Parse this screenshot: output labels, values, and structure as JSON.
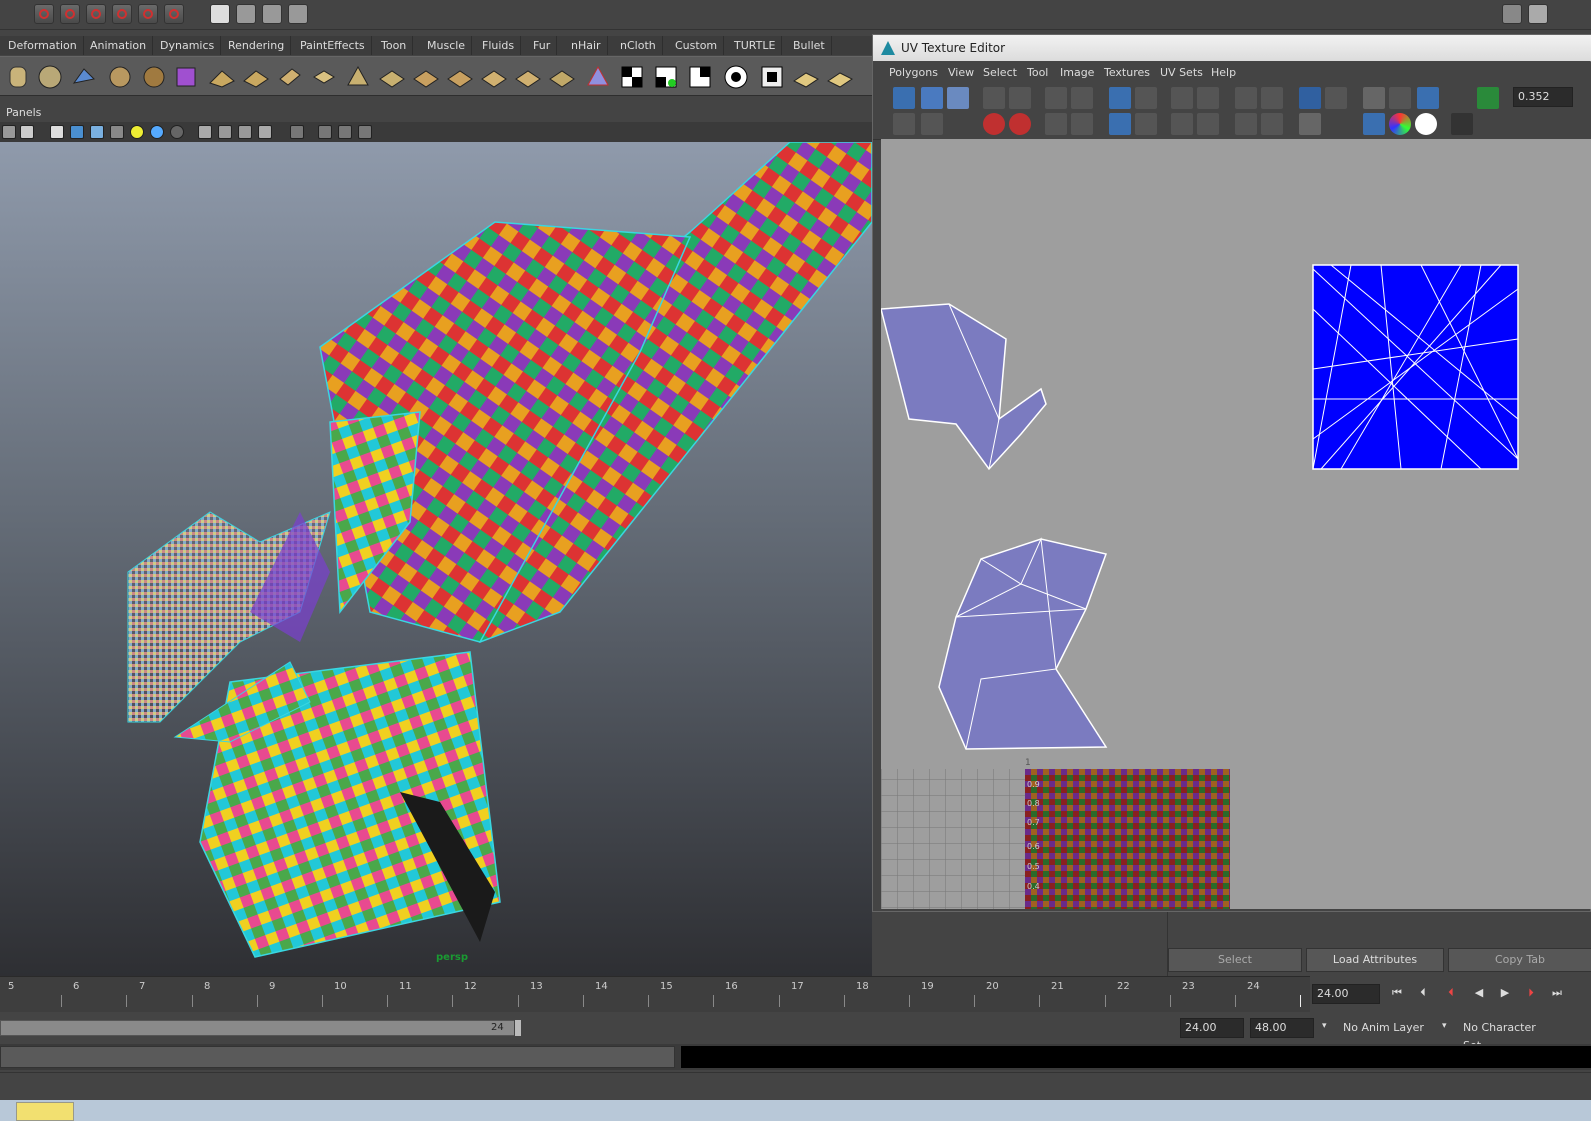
{
  "shelf_tabs": [
    "Deformation",
    "Animation",
    "Dynamics",
    "Rendering",
    "PaintEffects",
    "Toon",
    "Muscle",
    "Fluids",
    "Fur",
    "nHair",
    "nCloth",
    "Custom",
    "TURTLE",
    "Bullet"
  ],
  "panels_menu": "Panels",
  "camera_label": "persp",
  "uv_editor": {
    "title": "UV Texture Editor",
    "menus": [
      "Polygons",
      "View",
      "Select",
      "Tool",
      "Image",
      "Textures",
      "UV Sets",
      "Help"
    ],
    "value": "0.352",
    "tile_label": "1",
    "texture_labels": [
      "0.9",
      "0.8",
      "0.7",
      "0.6",
      "0.5",
      "0.4"
    ]
  },
  "attribute_buttons": [
    "Select",
    "Load Attributes",
    "Copy Tab"
  ],
  "timeline": {
    "ticks": [
      "5",
      "6",
      "7",
      "8",
      "9",
      "10",
      "11",
      "12",
      "13",
      "14",
      "15",
      "16",
      "17",
      "18",
      "19",
      "20",
      "21",
      "22",
      "23",
      "24"
    ],
    "current_time": "24.00"
  },
  "range": {
    "slider_label": "24",
    "end_time": "24.00",
    "playback_end": "48.00",
    "anim_layer": "No Anim Layer",
    "character_set": "No Character Set"
  },
  "colors": {
    "uv_shell_fill": "#7b7bc0",
    "texture_preview_fill": "#0000ff",
    "accent_cyan": "#3ad6e0",
    "camera_label_color": "#1a9a32"
  },
  "icons": {
    "playback": [
      "go-to-start-icon",
      "step-back-key-icon",
      "step-back-frame-icon",
      "play-backward-icon",
      "play-forward-icon",
      "step-forward-key-icon",
      "go-to-end-icon"
    ],
    "topbar": [
      "magnet-snap-icon",
      "render-icon",
      "ipr-render-icon",
      "render-settings-icon"
    ]
  }
}
